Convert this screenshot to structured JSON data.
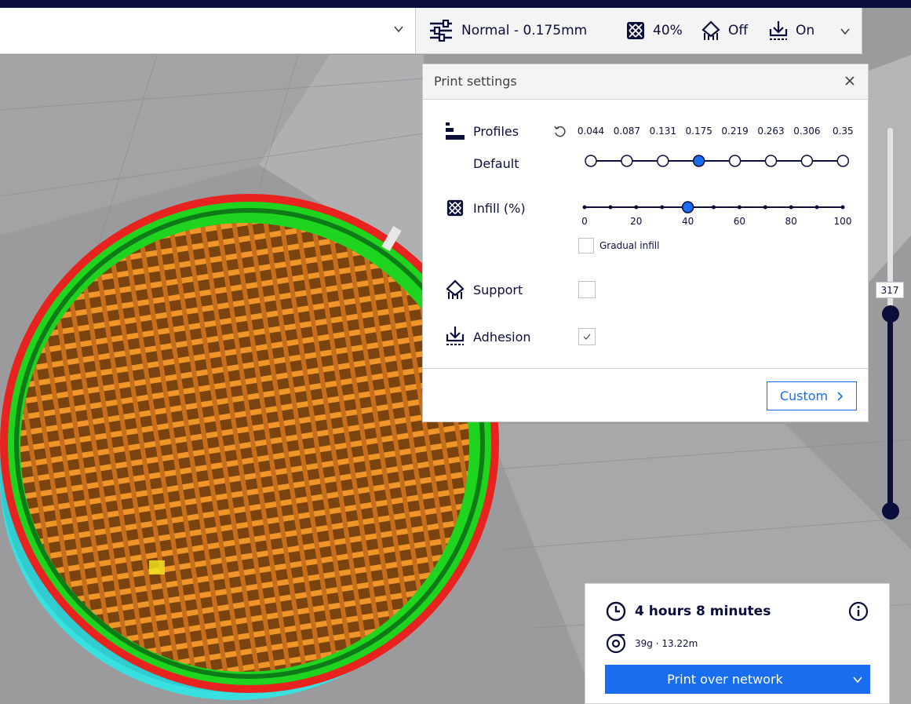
{
  "header": {
    "profile_summary": "Normal - 0.175mm",
    "infill": "40%",
    "support": "Off",
    "adhesion": "On"
  },
  "panel": {
    "title": "Print settings",
    "profiles_label": "Profiles",
    "default_label": "Default",
    "layer_heights": [
      "0.044",
      "0.087",
      "0.131",
      "0.175",
      "0.219",
      "0.263",
      "0.306",
      "0.35"
    ],
    "selected_layer_index": 3,
    "infill_label": "Infill (%)",
    "infill_ticks": [
      "0",
      "20",
      "40",
      "60",
      "80",
      "100"
    ],
    "infill_value": 40,
    "gradual_infill_label": "Gradual infill",
    "gradual_infill_checked": false,
    "support_label": "Support",
    "support_checked": false,
    "adhesion_label": "Adhesion",
    "adhesion_checked": true,
    "custom_button": "Custom"
  },
  "layer_slider": {
    "value": "317"
  },
  "action": {
    "print_time": "4 hours 8 minutes",
    "material": "39g · 13.22m",
    "print_button": "Print over network"
  },
  "colors": {
    "accent": "#196ef0",
    "dark": "#0b0e3a",
    "wall_outer": "#e8231f",
    "wall_inner": "#1fd41f",
    "infill": "#f09628",
    "skirt": "#38e0e0"
  }
}
